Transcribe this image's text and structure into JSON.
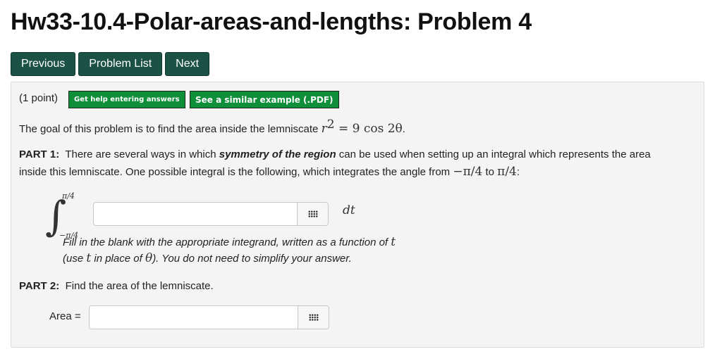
{
  "page": {
    "title": "Hw33-10.4-Polar-areas-and-lengths: Problem 4"
  },
  "nav": {
    "previous": "Previous",
    "problem_list": "Problem List",
    "next": "Next"
  },
  "problem": {
    "points": "(1 point)",
    "help_button": "Get help entering answers",
    "example_button": "See a similar example (.PDF)",
    "goal_text": "The goal of this problem is to find the area inside the lemniscate",
    "goal_math_lhs": "r",
    "goal_math_exp": "2",
    "goal_math_rhs": " = 9 cos 2θ",
    "goal_end": ".",
    "part1_label": "PART 1:",
    "part1_text_a": "There are several ways in which",
    "part1_emph": "symmetry of the region",
    "part1_text_b": "can be used when setting up an integral which represents the area",
    "part1_line2_a": "inside this lemniscate. One possible integral is the following, which integrates the angle from",
    "part1_from": "−π/4",
    "part1_to_word": "to",
    "part1_to": "π/4",
    "part1_colon": ":",
    "integral_upper": "π/4",
    "integral_lower": "−π/4",
    "integral_sign": "∫",
    "integrand_value": "",
    "dt": "dt",
    "fill_note_1a": "Fill in the blank with the appropriate integrand, written as a function of",
    "fill_note_1_var": "t",
    "fill_note_2a": "(use",
    "fill_note_2_var": "t",
    "fill_note_2b": "in place of",
    "fill_note_2_theta": "θ",
    "fill_note_2c": "). You do not need to simplify your answer.",
    "part2_label": "PART 2:",
    "part2_text": "Find the area of the lemniscate.",
    "area_label": "Area =",
    "area_value": ""
  },
  "icons": {
    "answer_palette": "grid-icon"
  },
  "colors": {
    "nav_button": "#1c5146",
    "help_button": "#0f8f3a",
    "panel_bg": "#f4f4f4"
  }
}
